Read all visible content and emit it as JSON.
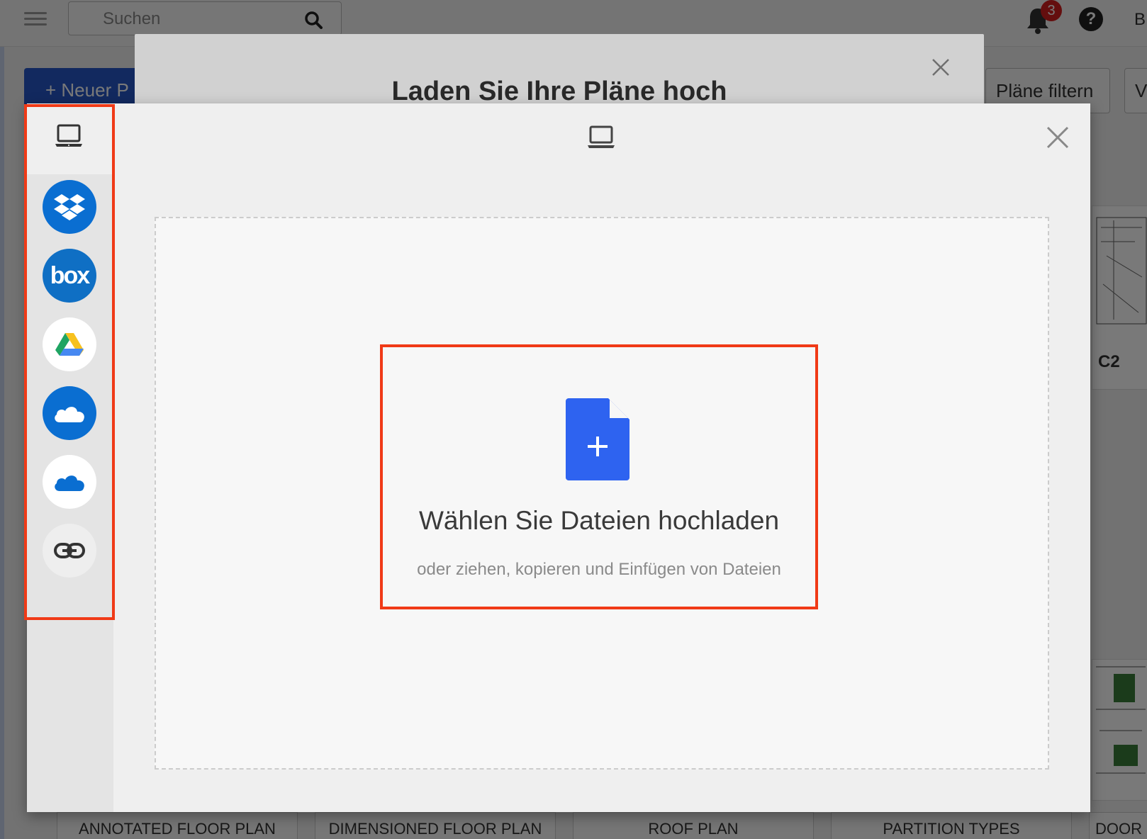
{
  "app": {
    "search_placeholder": "Suchen",
    "notification_count": "3",
    "help_label": "?",
    "user_initial": "B",
    "new_button_label": "+ Neuer P",
    "filter_button_label": "Pläne filtern",
    "view_button_label": "V",
    "partial_card_label": "C2",
    "thumbnail_labels": [
      "ANNOTATED FLOOR PLAN",
      "DIMENSIONED FLOOR PLAN",
      "ROOF PLAN",
      "PARTITION TYPES",
      "DOOR"
    ]
  },
  "upload_modal": {
    "title": "Laden Sie Ihre Pläne hoch"
  },
  "picker": {
    "sources": [
      {
        "name": "Mein Gerät",
        "icon": "laptop-icon",
        "color": "#ffffff"
      },
      {
        "name": "Dropbox",
        "icon": "dropbox-icon",
        "color": "#0a6ed1"
      },
      {
        "name": "Box",
        "icon": "box-icon",
        "color": "#0f6fc4"
      },
      {
        "name": "Google Drive",
        "icon": "google-drive-icon",
        "color": "#ffffff"
      },
      {
        "name": "OneDrive",
        "icon": "onedrive-icon",
        "color": "#0a6ed1"
      },
      {
        "name": "OneDrive for Business",
        "icon": "onedrive-business-icon",
        "color": "#ffffff"
      },
      {
        "name": "Link (URL)",
        "icon": "link-icon",
        "color": "#eeeeee"
      }
    ],
    "box_text": "box",
    "drop_title": "Wählen Sie Dateien hochladen",
    "drop_subtitle": "oder ziehen, kopieren und Einfügen von Dateien",
    "accent_color": "#2e63f0",
    "highlight_color": "#f03a17"
  }
}
